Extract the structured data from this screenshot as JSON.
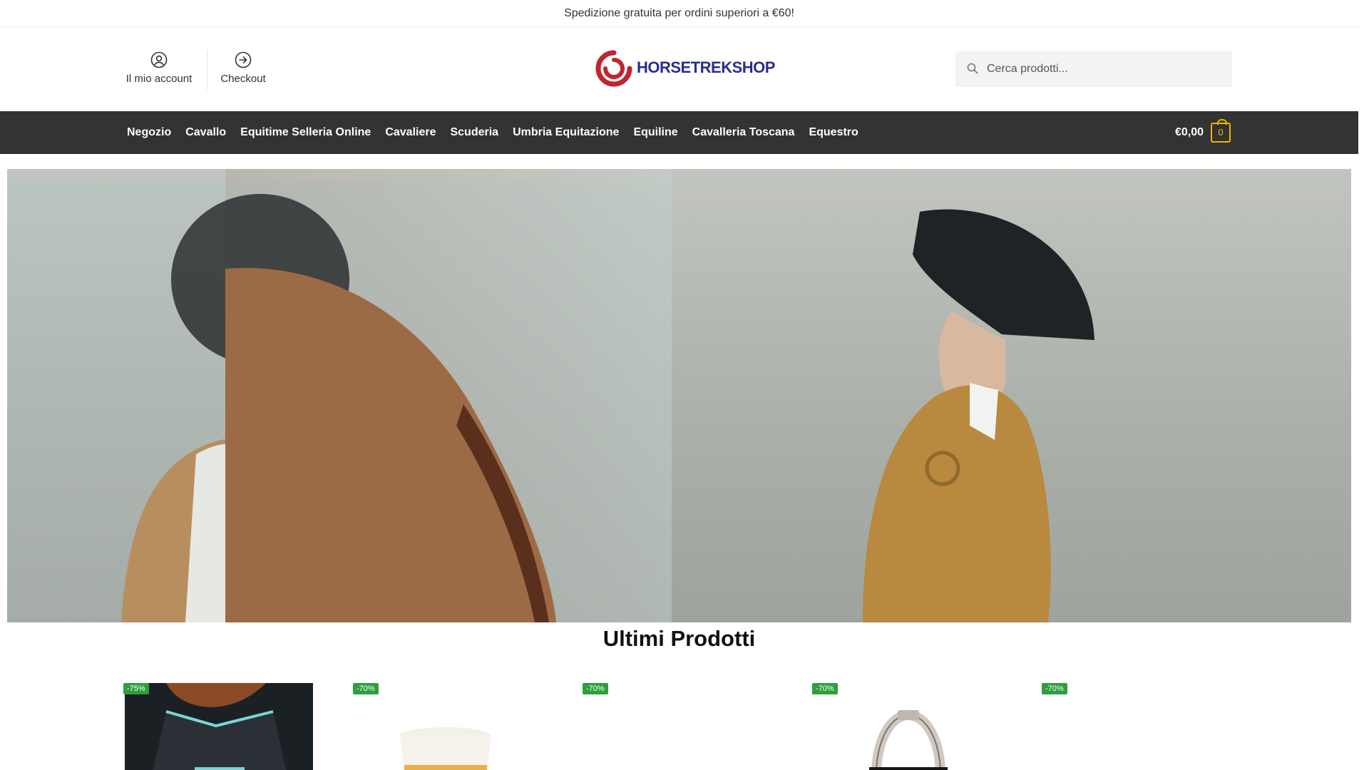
{
  "topbar": {
    "message": "Spedizione gratuita per ordini superiori a €60!"
  },
  "header": {
    "account_label": "Il mio account",
    "checkout_label": "Checkout",
    "logo_text": "HORSETREKSHOP",
    "search_placeholder": "Cerca prodotti..."
  },
  "nav": {
    "items": [
      {
        "label": "Negozio"
      },
      {
        "label": "Cavallo"
      },
      {
        "label": "Equitime Selleria Online"
      },
      {
        "label": "Cavaliere"
      },
      {
        "label": "Scuderia"
      },
      {
        "label": "Umbria Equitazione"
      },
      {
        "label": "Equiline"
      },
      {
        "label": "Cavalleria Toscana"
      },
      {
        "label": "Equestro"
      }
    ],
    "cart_total": "€0,00",
    "cart_count": "0"
  },
  "main": {
    "section_title": "Ultimi Prodotti",
    "products": [
      {
        "badge": "-75%"
      },
      {
        "badge": "-70%"
      },
      {
        "badge": "-70%"
      },
      {
        "badge": "-70%"
      },
      {
        "badge": "-70%"
      }
    ]
  },
  "colors": {
    "nav_background": "#333333",
    "cart_accent": "#f0b400",
    "badge": "#2e9e3e",
    "logo_red": "#c0262d",
    "logo_blue": "#2a2f8a"
  }
}
